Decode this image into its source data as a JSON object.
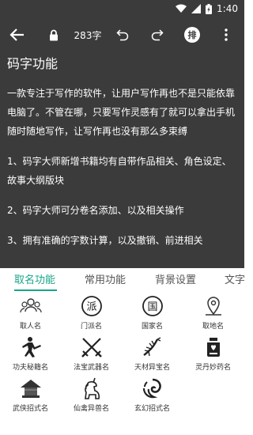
{
  "status_bar": {
    "time": "1:40"
  },
  "toolbar": {
    "word_count": "283字",
    "pai_label": "排"
  },
  "document": {
    "title": "码字功能",
    "paragraphs": [
      "一款专注于写作的软件，让用户写作再也不是只能依靠电脑了。不管在哪，只要写作灵感有了就可以拿出手机随时随地写作，让写作再也没有那么多束缚",
      "    1、码字大师新增书籍均有自带作品相关、角色设定、故事大纲版块",
      "    2、码字大师可分卷名添加、以及相关操作",
      "    3、拥有准确的字数计算，以及撤销、前进相关"
    ]
  },
  "tabs": [
    {
      "label": "取名功能",
      "active": true
    },
    {
      "label": "常用功能",
      "active": false
    },
    {
      "label": "背景设置",
      "active": false
    },
    {
      "label": "文字",
      "active": false
    }
  ],
  "tools": [
    {
      "label": "取人名",
      "icon": "people-icon"
    },
    {
      "label": "门派名",
      "icon": "sect-icon"
    },
    {
      "label": "国家名",
      "icon": "country-icon"
    },
    {
      "label": "取地名",
      "icon": "location-icon"
    },
    {
      "label": "功夫秘籍名",
      "icon": "kungfu-icon"
    },
    {
      "label": "法宝武器名",
      "icon": "swords-icon"
    },
    {
      "label": "天材异宝名",
      "icon": "ginseng-icon"
    },
    {
      "label": "灵丹妙药名",
      "icon": "medicine-jar-icon"
    },
    {
      "label": "武侠招式名",
      "icon": "wuxia-hat-icon"
    },
    {
      "label": "仙禽异兽名",
      "icon": "unicorn-icon"
    },
    {
      "label": "玄幻招式名",
      "icon": "fantasy-swirl-icon"
    }
  ],
  "colors": {
    "toolbar_bg": "#3b3b3b",
    "accent": "#1aa58c"
  }
}
